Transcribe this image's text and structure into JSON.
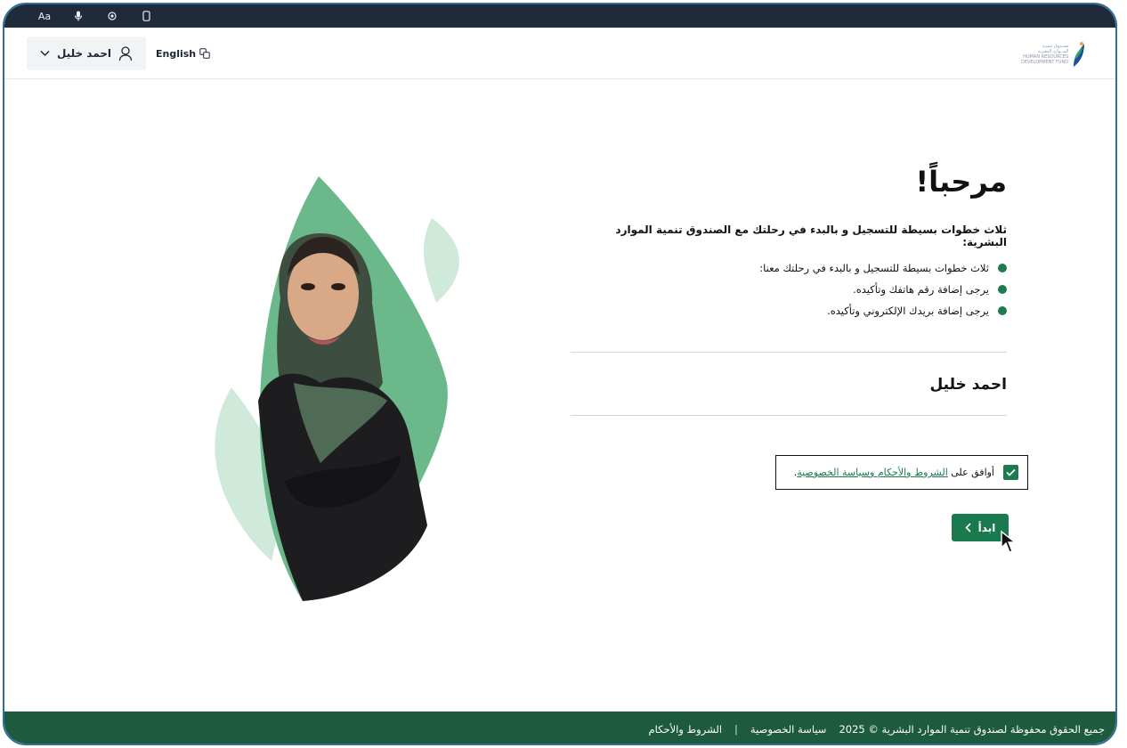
{
  "a11y_toolbar": {
    "items": [
      {
        "name": "font-size-icon",
        "label": "Aa"
      },
      {
        "name": "microphone-icon",
        "label": ""
      },
      {
        "name": "eye-icon",
        "label": ""
      },
      {
        "name": "mobile-icon",
        "label": ""
      }
    ]
  },
  "header": {
    "user_name": "احمد خليل",
    "language_label": "English",
    "logo": {
      "line1": "صنـدوق تنميـة",
      "line2": "المــوارد البشرية",
      "line3": "HUMAN RESOURCES",
      "line4": "DEVELOPMENT FUND"
    }
  },
  "main": {
    "title": "مرحباً!",
    "intro": "ثلاث خطوات بسيطة للتسجيل و بالبدء في رحلتك مع الصندوق تنمية الموارد البشرية:",
    "steps": [
      "ثلاث خطوات بسيطة للتسجيل و بالبدء في رحلتك معنا:",
      "يرجى إضافة رقم هاتفك وتأكيده.",
      "يرجى إضافة بريدك الإلكتروني وتأكيده."
    ],
    "user_name": "احمد خليل",
    "agree_prefix": "أوافق على ",
    "agree_link": "الشروط والأحكام وسياسة الخصوصية",
    "agree_suffix": ".",
    "agree_checked": true,
    "start_label": "ابدأ"
  },
  "footer": {
    "copyright": "جميع الحقوق محفوظة لصندوق تنمية الموارد البشرية © 2025",
    "privacy": "سياسة الخصوصية",
    "separator": "|",
    "terms": "الشروط والأحكام"
  },
  "colors": {
    "primary_green": "#1a7a4f",
    "footer_green": "#1e5a3d",
    "toolbar_dark": "#1f2a3a",
    "leaf_green": "#6bb98a",
    "leaf_light": "#cfe9db"
  }
}
